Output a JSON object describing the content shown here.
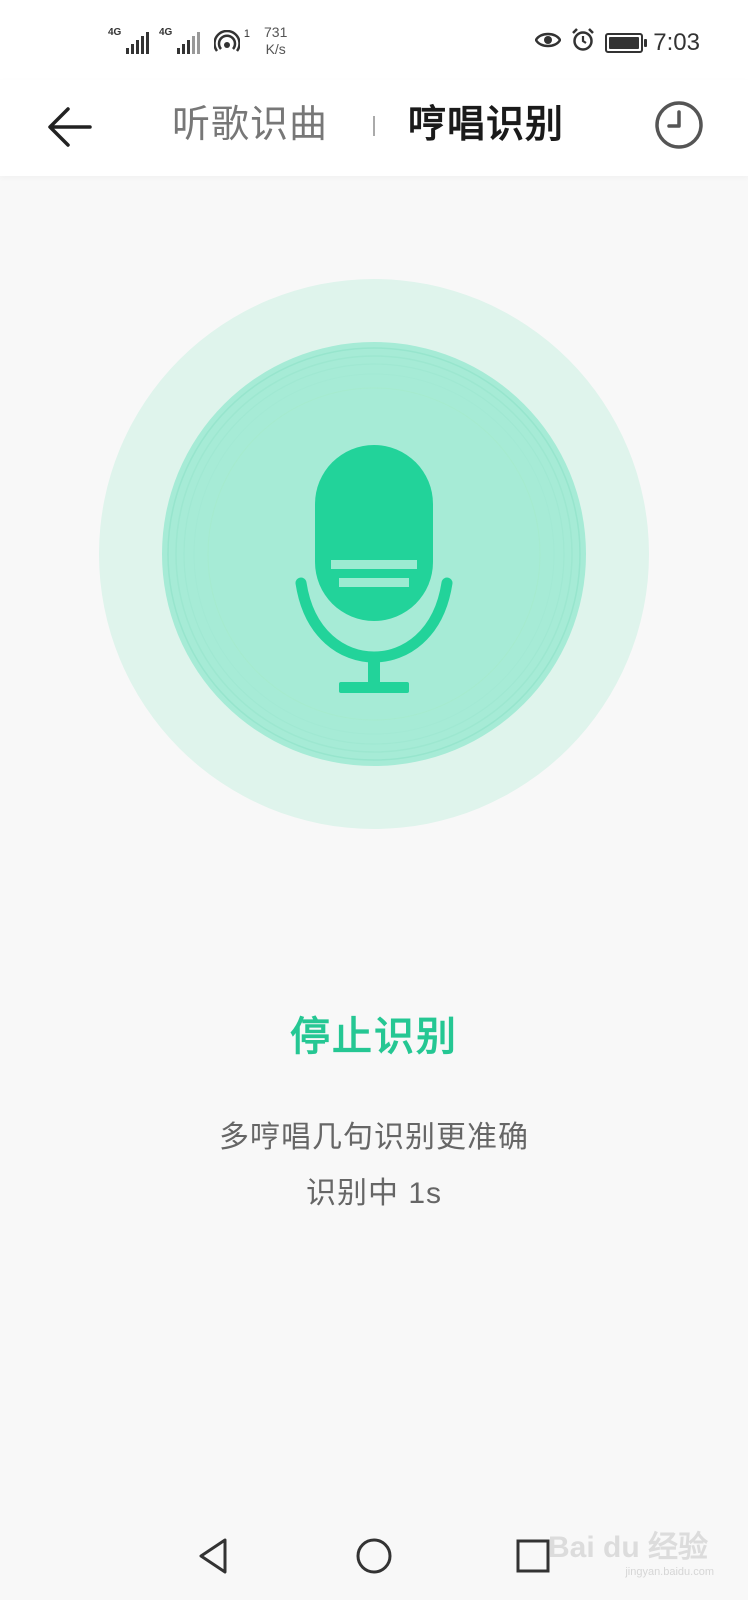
{
  "status_bar": {
    "network_1": "4G",
    "network_2": "4G",
    "hotspot_count": "1",
    "speed_value": "731",
    "speed_unit": "K/s",
    "time": "7:03"
  },
  "header": {
    "tabs": [
      {
        "label": "听歌识曲",
        "active": false
      },
      {
        "label": "哼唱识别",
        "active": true
      }
    ]
  },
  "main": {
    "stop_label": "停止识别",
    "hint": "多哼唱几句识别更准确",
    "progress_text": "识别中 1s"
  },
  "watermark": {
    "text": "Bai du 经验",
    "sub": "jingyan.baidu.com"
  },
  "colors": {
    "accent": "#25c793",
    "mic": "#22d39a",
    "outer_ring": "#dff4ec",
    "inner_ring": "#a6ebd6"
  },
  "icons": {
    "back": "arrow-left-icon",
    "history": "clock-icon",
    "mic": "microphone-icon",
    "nav_back": "triangle-back-icon",
    "nav_home": "circle-home-icon",
    "nav_recent": "square-recent-icon"
  }
}
